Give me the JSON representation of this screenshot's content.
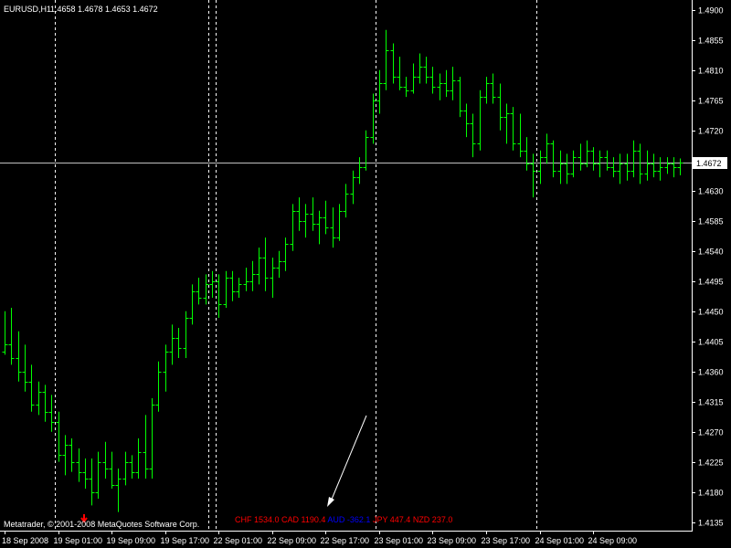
{
  "header": {
    "symbol": "EURUSD,H1",
    "ohlc": "1.4658 1.4678 1.4653 1.4672"
  },
  "footer": {
    "copyright": "Metatrader, © 2001-2008 MetaQuotes Software Corp."
  },
  "overlay_labels": [
    {
      "text": "CHF 1534.0",
      "color": "#ff0000"
    },
    {
      "text": "CAD 1190.4",
      "color": "#ff0000"
    },
    {
      "text": "AUD -362.1",
      "color": "#0000ff"
    },
    {
      "text": "JPY 447.4",
      "color": "#ff0000"
    },
    {
      "text": "NZD 237.0",
      "color": "#ff0000"
    }
  ],
  "colors": {
    "background": "#000000",
    "bars": "#00ff00",
    "axis_text": "#ffffff",
    "grid_line": "#ffffff",
    "price_line": "#c0c0c0",
    "arrow": "#ffffff",
    "marker": "#ff0000"
  },
  "chart_data": {
    "type": "ohlc",
    "symbol": "EURUSD",
    "timeframe": "H1",
    "current_price": 1.4672,
    "current_price_label": "1.4672",
    "ylim": [
      1.4125,
      1.4912
    ],
    "y_ticks": [
      "1.4900",
      "1.4855",
      "1.4810",
      "1.4765",
      "1.4720",
      "1.4675",
      "1.4630",
      "1.4585",
      "1.4540",
      "1.4495",
      "1.4450",
      "1.4405",
      "1.4360",
      "1.4315",
      "1.4270",
      "1.4225",
      "1.4180",
      "1.4135"
    ],
    "x_labels": [
      "18 Sep 2008",
      "19 Sep 01:00",
      "19 Sep 09:00",
      "19 Sep 17:00",
      "22 Sep 01:00",
      "22 Sep 09:00",
      "22 Sep 17:00",
      "23 Sep 01:00",
      "23 Sep 09:00",
      "23 Sep 17:00",
      "24 Sep 01:00",
      "24 Sep 09:00"
    ],
    "x_label_bar_index": [
      0,
      8,
      16,
      24,
      32,
      40,
      48,
      56,
      64,
      72,
      80,
      88
    ],
    "day_separators_at_bar": [
      7.5,
      30.5,
      31.5,
      55.5,
      79.5
    ],
    "bars": [
      [
        1.439,
        1.445,
        1.4385,
        1.44
      ],
      [
        1.44,
        1.4455,
        1.437,
        1.438
      ],
      [
        1.438,
        1.442,
        1.4345,
        1.436
      ],
      [
        1.436,
        1.44,
        1.433,
        1.4345
      ],
      [
        1.4345,
        1.437,
        1.43,
        1.431
      ],
      [
        1.431,
        1.4345,
        1.4295,
        1.433
      ],
      [
        1.433,
        1.434,
        1.4285,
        1.43
      ],
      [
        1.43,
        1.4325,
        1.427,
        1.4285
      ],
      [
        1.4285,
        1.43,
        1.4225,
        1.4235
      ],
      [
        1.4235,
        1.4265,
        1.4205,
        1.425
      ],
      [
        1.425,
        1.426,
        1.421,
        1.4225
      ],
      [
        1.4225,
        1.4245,
        1.4195,
        1.421
      ],
      [
        1.421,
        1.423,
        1.4185,
        1.42
      ],
      [
        1.42,
        1.423,
        1.416,
        1.418
      ],
      [
        1.418,
        1.424,
        1.417,
        1.4225
      ],
      [
        1.4225,
        1.4255,
        1.42,
        1.4215
      ],
      [
        1.4215,
        1.424,
        1.4185,
        1.419
      ],
      [
        1.419,
        1.4215,
        1.415,
        1.42
      ],
      [
        1.42,
        1.424,
        1.419,
        1.4225
      ],
      [
        1.4225,
        1.4235,
        1.42,
        1.421
      ],
      [
        1.421,
        1.426,
        1.42,
        1.424
      ],
      [
        1.424,
        1.4295,
        1.42,
        1.4215
      ],
      [
        1.4215,
        1.432,
        1.42,
        1.431
      ],
      [
        1.431,
        1.4375,
        1.43,
        1.436
      ],
      [
        1.436,
        1.44,
        1.433,
        1.439
      ],
      [
        1.439,
        1.443,
        1.437,
        1.441
      ],
      [
        1.441,
        1.4425,
        1.438,
        1.4395
      ],
      [
        1.4395,
        1.445,
        1.438,
        1.444
      ],
      [
        1.444,
        1.449,
        1.443,
        1.448
      ],
      [
        1.448,
        1.45,
        1.446,
        1.447
      ],
      [
        1.447,
        1.4505,
        1.446,
        1.449
      ],
      [
        1.449,
        1.451,
        1.447,
        1.4495
      ],
      [
        1.4495,
        1.4505,
        1.444,
        1.446
      ],
      [
        1.446,
        1.451,
        1.4455,
        1.45
      ],
      [
        1.45,
        1.451,
        1.4465,
        1.448
      ],
      [
        1.448,
        1.45,
        1.447,
        1.449
      ],
      [
        1.449,
        1.4515,
        1.448,
        1.4495
      ],
      [
        1.4495,
        1.4525,
        1.448,
        1.4505
      ],
      [
        1.4505,
        1.4545,
        1.449,
        1.453
      ],
      [
        1.453,
        1.456,
        1.448,
        1.45
      ],
      [
        1.45,
        1.453,
        1.447,
        1.4515
      ],
      [
        1.4515,
        1.454,
        1.45,
        1.4525
      ],
      [
        1.4525,
        1.456,
        1.451,
        1.455
      ],
      [
        1.455,
        1.461,
        1.454,
        1.46
      ],
      [
        1.46,
        1.462,
        1.457,
        1.4585
      ],
      [
        1.4585,
        1.461,
        1.456,
        1.4595
      ],
      [
        1.4595,
        1.462,
        1.457,
        1.458
      ],
      [
        1.458,
        1.46,
        1.455,
        1.459
      ],
      [
        1.459,
        1.4615,
        1.4565,
        1.4575
      ],
      [
        1.4575,
        1.4605,
        1.4545,
        1.456
      ],
      [
        1.456,
        1.461,
        1.4555,
        1.46
      ],
      [
        1.46,
        1.464,
        1.459,
        1.4625
      ],
      [
        1.4625,
        1.466,
        1.461,
        1.465
      ],
      [
        1.465,
        1.468,
        1.464,
        1.4665
      ],
      [
        1.4665,
        1.472,
        1.466,
        1.471
      ],
      [
        1.471,
        1.4775,
        1.47,
        1.4765
      ],
      [
        1.4765,
        1.481,
        1.4745,
        1.479
      ],
      [
        1.479,
        1.487,
        1.478,
        1.484
      ],
      [
        1.484,
        1.485,
        1.479,
        1.48
      ],
      [
        1.48,
        1.483,
        1.478,
        1.4785
      ],
      [
        1.4785,
        1.48,
        1.477,
        1.478
      ],
      [
        1.478,
        1.482,
        1.4775,
        1.48
      ],
      [
        1.48,
        1.4835,
        1.479,
        1.4815
      ],
      [
        1.4815,
        1.483,
        1.479,
        1.48
      ],
      [
        1.48,
        1.4815,
        1.4775,
        1.4785
      ],
      [
        1.4785,
        1.4805,
        1.4765,
        1.479
      ],
      [
        1.479,
        1.481,
        1.477,
        1.478
      ],
      [
        1.478,
        1.4815,
        1.4765,
        1.4795
      ],
      [
        1.4795,
        1.48,
        1.474,
        1.475
      ],
      [
        1.475,
        1.476,
        1.471,
        1.473
      ],
      [
        1.473,
        1.4745,
        1.468,
        1.47
      ],
      [
        1.47,
        1.478,
        1.469,
        1.477
      ],
      [
        1.477,
        1.48,
        1.476,
        1.479
      ],
      [
        1.479,
        1.4805,
        1.476,
        1.477
      ],
      [
        1.477,
        1.479,
        1.472,
        1.474
      ],
      [
        1.474,
        1.476,
        1.47,
        1.4745
      ],
      [
        1.4745,
        1.4755,
        1.469,
        1.47
      ],
      [
        1.47,
        1.4745,
        1.468,
        1.469
      ],
      [
        1.469,
        1.471,
        1.466,
        1.467
      ],
      [
        1.467,
        1.4685,
        1.462,
        1.466
      ],
      [
        1.466,
        1.469,
        1.464,
        1.468
      ],
      [
        1.468,
        1.4715,
        1.467,
        1.47
      ],
      [
        1.47,
        1.4705,
        1.465,
        1.466
      ],
      [
        1.466,
        1.469,
        1.464,
        1.467
      ],
      [
        1.467,
        1.4685,
        1.464,
        1.4655
      ],
      [
        1.4655,
        1.469,
        1.465,
        1.468
      ],
      [
        1.468,
        1.47,
        1.466,
        1.467
      ],
      [
        1.467,
        1.4705,
        1.4665,
        1.469
      ],
      [
        1.469,
        1.4695,
        1.466,
        1.467
      ],
      [
        1.467,
        1.469,
        1.465,
        1.468
      ],
      [
        1.468,
        1.469,
        1.466,
        1.4665
      ],
      [
        1.4665,
        1.468,
        1.465,
        1.466
      ],
      [
        1.466,
        1.4685,
        1.464,
        1.467
      ],
      [
        1.467,
        1.4685,
        1.4645,
        1.466
      ],
      [
        1.466,
        1.4705,
        1.465,
        1.469
      ],
      [
        1.469,
        1.47,
        1.464,
        1.4655
      ],
      [
        1.4655,
        1.469,
        1.4645,
        1.467
      ],
      [
        1.467,
        1.4685,
        1.465,
        1.466
      ],
      [
        1.466,
        1.468,
        1.4645,
        1.4665
      ],
      [
        1.4665,
        1.468,
        1.4655,
        1.467
      ],
      [
        1.467,
        1.468,
        1.465,
        1.4665
      ],
      [
        1.4665,
        1.4678,
        1.4653,
        1.4672
      ]
    ]
  }
}
